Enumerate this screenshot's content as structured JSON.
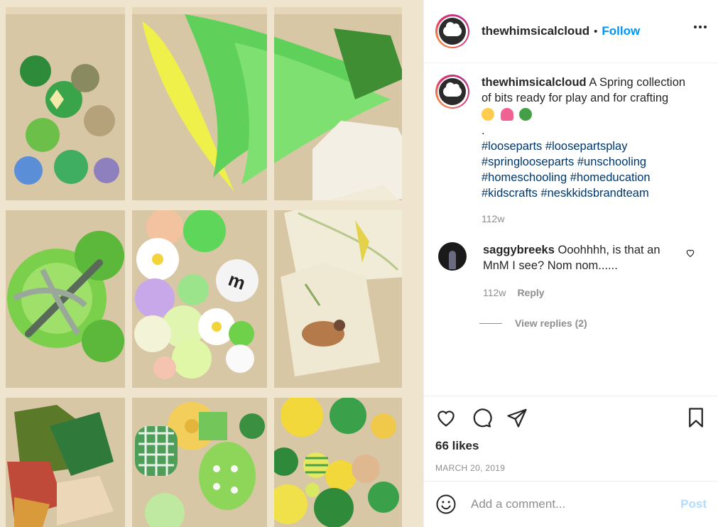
{
  "header": {
    "username": "thewhimsicalcloud",
    "separator": "•",
    "follow_label": "Follow"
  },
  "caption": {
    "username": "thewhimsicalcloud",
    "text": "A Spring collection of bits ready for play and for crafting",
    "emojis": [
      "smiling-face-with-heart-eyes",
      "tulip",
      "deciduous-tree"
    ],
    "dot": ".",
    "hashtags": [
      "#looseparts",
      "#loosepartsplay",
      "#springlooseparts",
      "#unschooling",
      "#homeschooling",
      "#homeducation",
      "#kidscrafts",
      "#neskkidsbrandteam"
    ],
    "age": "112w"
  },
  "comment": {
    "username": "saggybreeks",
    "text": "Ooohhhh, is that an MnM I see? Nom nom......",
    "age": "112w",
    "reply_label": "Reply",
    "view_replies_label": "View replies (2)"
  },
  "engagement": {
    "likes": "66 likes",
    "date": "MARCH 20, 2019"
  },
  "composer": {
    "placeholder": "Add a comment...",
    "post_label": "Post"
  },
  "colors": {
    "accent": "#0095f6",
    "hashtag": "#00376b",
    "muted": "#8e8e8e",
    "post_disabled": "#b3dbff"
  }
}
